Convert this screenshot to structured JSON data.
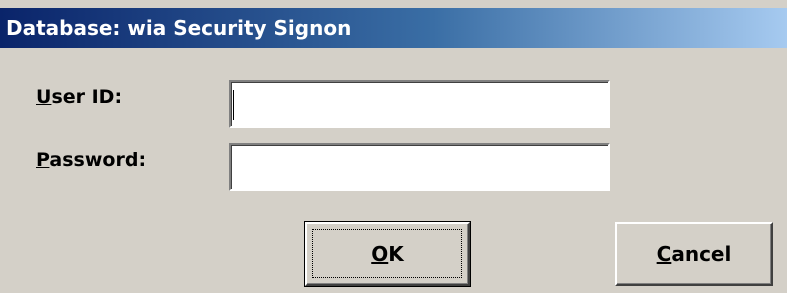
{
  "window": {
    "title": "Database: wia Security Signon"
  },
  "form": {
    "user_id": {
      "label_mnemonic": "U",
      "label_rest": "ser ID:",
      "value": ""
    },
    "password": {
      "label_mnemonic": "P",
      "label_rest": "assword:",
      "value": ""
    }
  },
  "buttons": {
    "ok": {
      "mnemonic": "O",
      "rest": "K"
    },
    "cancel": {
      "mnemonic": "C",
      "rest": "ancel"
    }
  },
  "colors": {
    "dialog_face": "#d4d0c8",
    "title_start": "#0a246a",
    "title_end": "#a6caf0",
    "title_text": "#ffffff"
  }
}
